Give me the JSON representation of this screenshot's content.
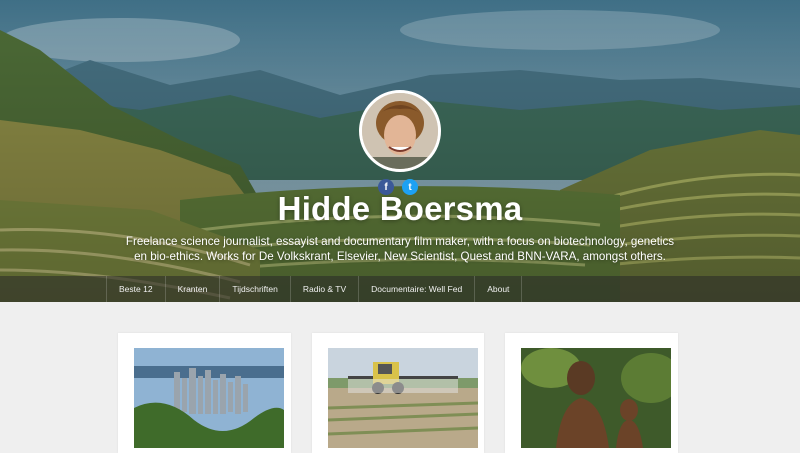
{
  "header": {
    "title": "Hidde Boersma",
    "tagline": "Freelance science journalist, essayist and documentary film maker, with a focus  on biotechnology, genetics en bio-ethics. Works for De Volkskrant, Elsevier, New Scientist, Quest and BNN-VARA, amongst others.",
    "social": {
      "facebook_icon": "f",
      "twitter_icon": "t"
    }
  },
  "nav": {
    "items": [
      {
        "label": "Beste 12"
      },
      {
        "label": "Kranten"
      },
      {
        "label": "Tijdschriften"
      },
      {
        "label": "Radio & TV"
      },
      {
        "label": "Documentaire: Well Fed"
      },
      {
        "label": "About"
      }
    ]
  },
  "cards": [
    {
      "image": "city-skyline-photo"
    },
    {
      "image": "tractor-spraying-field-photo"
    },
    {
      "image": "man-and-child-in-forest-photo"
    }
  ],
  "colors": {
    "facebook": "#3b5998",
    "twitter": "#1da1f2",
    "nav_bg": "#282828"
  }
}
